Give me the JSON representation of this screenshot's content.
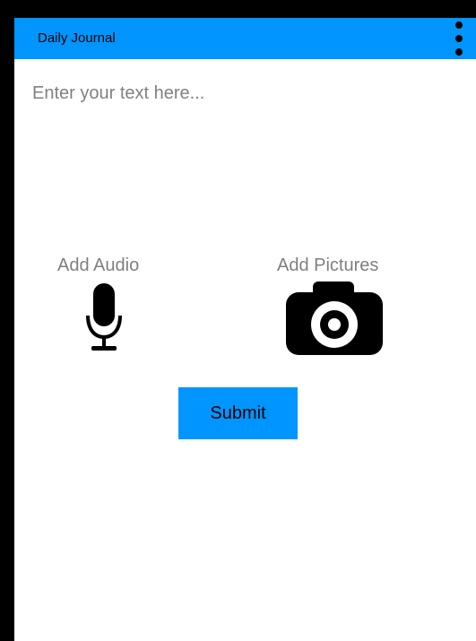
{
  "appbar": {
    "title": "Daily Journal",
    "menu_icon": "more-vert-icon",
    "background": "#0095ff"
  },
  "journal": {
    "placeholder": "Enter your text here...",
    "value": ""
  },
  "attachments": {
    "audio": {
      "label": "Add Audio",
      "icon": "microphone-icon"
    },
    "pictures": {
      "label": "Add Pictures",
      "icon": "camera-icon"
    }
  },
  "submit": {
    "label": "Submit",
    "background": "#0095ff"
  }
}
